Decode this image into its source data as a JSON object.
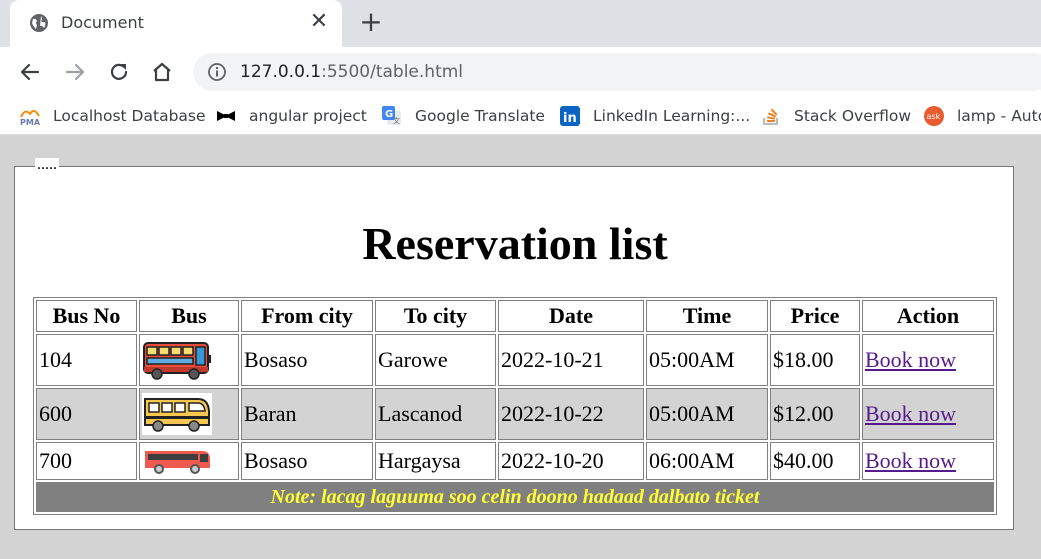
{
  "browser": {
    "tab_title": "Document",
    "tab_close": "✕",
    "new_tab": "+",
    "url_host": "127.0.0.1",
    "url_path": ":5500/table.html",
    "bookmarks": [
      {
        "label": "Localhost Database",
        "icon": "phpmyadmin-icon"
      },
      {
        "label": "angular project",
        "icon": "bowtie-icon"
      },
      {
        "label": "Google Translate",
        "icon": "google-translate-icon"
      },
      {
        "label": "LinkedIn Learning:...",
        "icon": "linkedin-icon"
      },
      {
        "label": "Stack Overflow",
        "icon": "stackoverflow-icon"
      },
      {
        "label": "lamp - Auto",
        "icon": "ask-icon"
      }
    ]
  },
  "page": {
    "legend": ".....",
    "title": "Reservation list",
    "headers": [
      "Bus No",
      "Bus",
      "From city",
      "To city",
      "Date",
      "Time",
      "Price",
      "Action"
    ],
    "rows": [
      {
        "bus_no": "104",
        "bus_icon": "red-double-bus-icon",
        "from": "Bosaso",
        "to": "Garowe",
        "date": "2022-10-21",
        "time": "05:00AM",
        "price": "$18.00",
        "action": "Book now",
        "shaded": false
      },
      {
        "bus_no": "600",
        "bus_icon": "yellow-bus-icon",
        "from": "Baran",
        "to": "Lascanod",
        "date": "2022-10-22",
        "time": "05:00AM",
        "price": "$12.00",
        "action": "Book now",
        "shaded": true
      },
      {
        "bus_no": "700",
        "bus_icon": "red-coach-bus-icon",
        "from": "Bosaso",
        "to": "Hargaysa",
        "date": "2022-10-20",
        "time": "06:00AM",
        "price": "$40.00",
        "action": "Book now",
        "shaded": false
      }
    ],
    "note": "Note: lacag laguuma soo celin doono hadaad dalbato ticket"
  },
  "colors": {
    "page_bg": "#d3d3d3",
    "shaded_row": "#d3d3d3",
    "note_bg": "#808080",
    "note_text": "#ffff33",
    "link": "#551a8b"
  }
}
